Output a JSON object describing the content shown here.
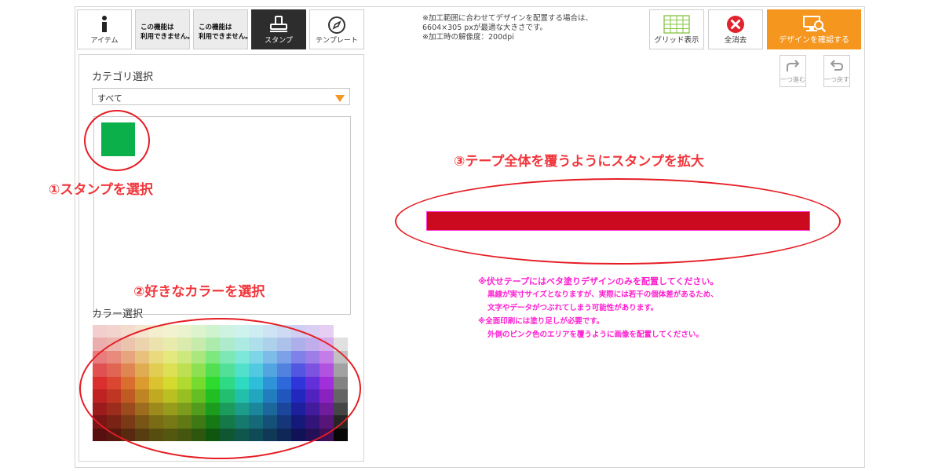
{
  "toolbar": {
    "items": [
      {
        "label": "アイテム",
        "icon": "info-icon"
      },
      {
        "label": "",
        "disabled_text": [
          "この機能は",
          "利用できません。"
        ]
      },
      {
        "label": "",
        "disabled_text": [
          "この機能は",
          "利用できません。"
        ]
      },
      {
        "label": "スタンプ",
        "icon": "stamp-icon"
      },
      {
        "label": "テンプレート",
        "icon": "compass-icon"
      }
    ]
  },
  "notice": {
    "line1": "※加工範囲に合わせてデザインを配置する場合は、",
    "line2": "6604×305 pxが最適な大きさです。",
    "line3": "※加工時の解像度：200dpi"
  },
  "actions": {
    "grid_label": "グリッド表示",
    "clear_label": "全消去",
    "confirm_label": "デザインを確認する",
    "redo_label": "一つ進む",
    "undo_label": "一つ戻す"
  },
  "panel": {
    "category_label": "カテゴリ選択",
    "category_value": "すべて",
    "color_label": "カラー選択"
  },
  "stamp": {
    "color": "#0bb04a"
  },
  "tape": {
    "color": "#cc0a1f"
  },
  "notes": {
    "line1": "※伏せテープにはベタ塗りデザインのみを配置してください。",
    "line2": "黒線が実寸サイズとなりますが、実際には若干の個体差があるため、",
    "line3": "文字やデータがつぶれてしまう可能性があります。",
    "line4": "※全面印刷には塗り足しが必要です。",
    "line5": "外側のピンク色のエリアを覆うように画像を配置してください。"
  },
  "annotations": {
    "step1": "①スタンプを選択",
    "step2": "②好きなカラーを選択",
    "step3": "③テープ全体を覆うようにスタンプを拡大"
  },
  "colors": {
    "accent": "#f5961e",
    "annotation": "#e51d25",
    "note_pink": "#ff1fd0",
    "active_tool": "#2d2d2d"
  }
}
